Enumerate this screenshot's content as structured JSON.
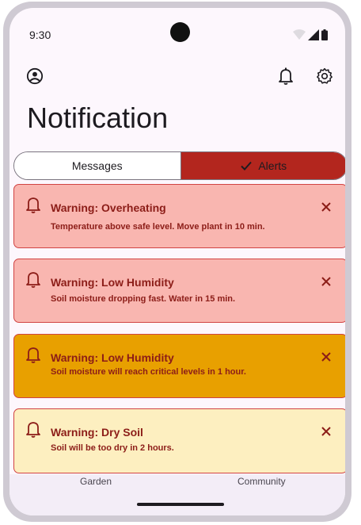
{
  "status": {
    "time": "9:30"
  },
  "header": {
    "title": "Notification"
  },
  "tabs": [
    {
      "label": "Messages",
      "selected": false
    },
    {
      "label": "Alerts",
      "selected": true
    }
  ],
  "alerts": [
    {
      "title": "Warning: Overheating",
      "body": "Temperature above safe level. Move plant in 10 min.",
      "bg": "#f9b6b0"
    },
    {
      "title": "Warning: Low Humidity",
      "body": "Soil moisture dropping fast. Water in 15 min.",
      "bg": "#f9b6b0"
    },
    {
      "title": "Warning: Low Humidity",
      "body": "Soil moisture will reach critical levels in 1 hour.",
      "bg": "#e8a000"
    },
    {
      "title": "Warning: Dry Soil",
      "body": "Soil will be too dry in 2 hours.",
      "bg": "#fdefc0"
    }
  ],
  "nav": {
    "items": [
      {
        "label": "Garden"
      },
      {
        "label": "Community"
      }
    ]
  },
  "colors": {
    "accent": "#b3261e",
    "alert_text": "#8c1d18",
    "border": "#d14343"
  }
}
